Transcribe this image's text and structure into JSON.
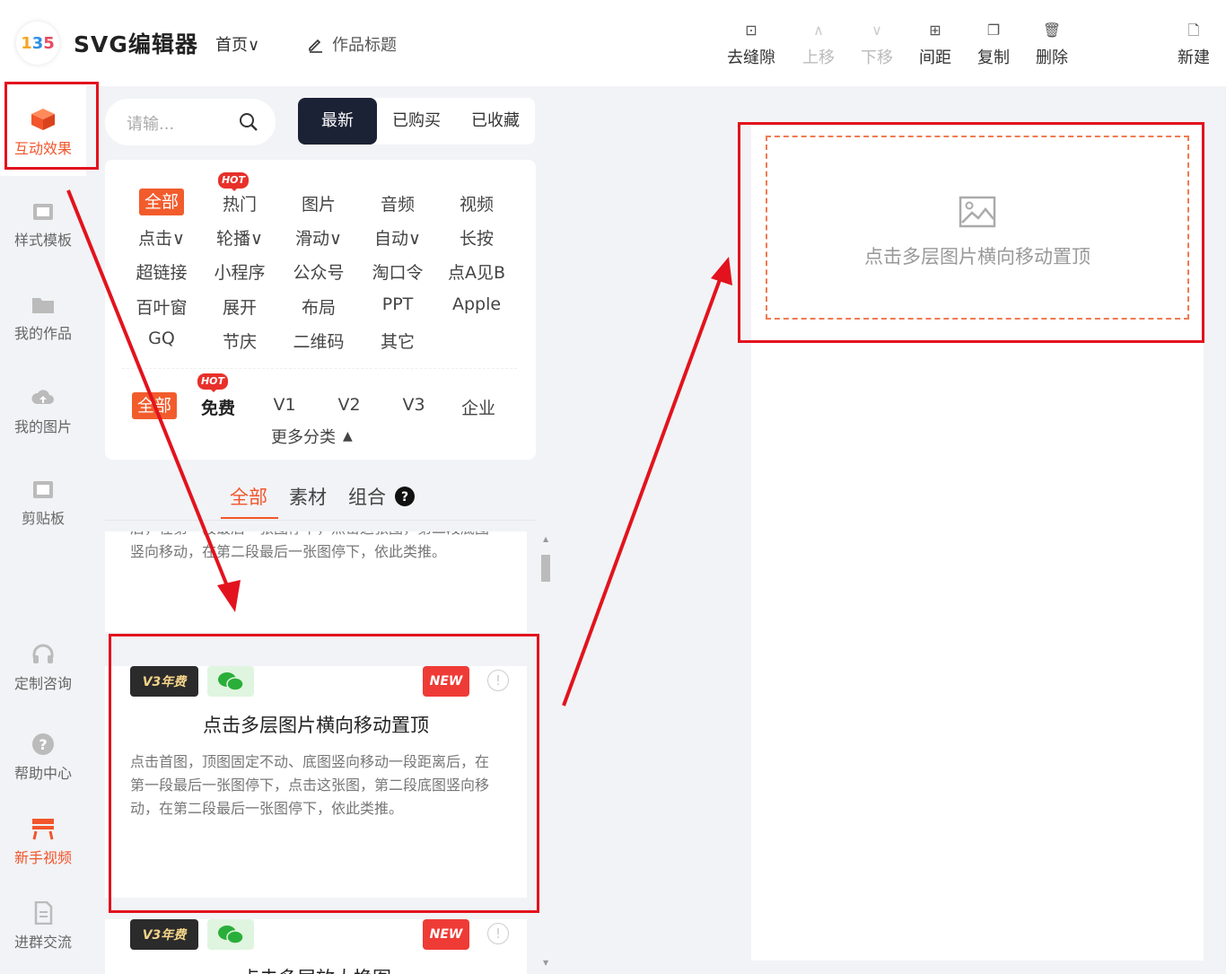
{
  "header": {
    "app_name": "SVG编辑器",
    "home_label": "首页∨",
    "work_title": "作品标题",
    "tools": [
      {
        "label": "去缝隙",
        "icon": "gap-icon",
        "disabled": false
      },
      {
        "label": "上移",
        "icon": "chevron-up-icon",
        "disabled": true
      },
      {
        "label": "下移",
        "icon": "chevron-down-icon",
        "disabled": true
      },
      {
        "label": "间距",
        "icon": "spacing-icon",
        "disabled": false
      },
      {
        "label": "复制",
        "icon": "copy-icon",
        "disabled": false
      },
      {
        "label": "删除",
        "icon": "trash-icon",
        "disabled": false
      },
      {
        "label": "新建",
        "icon": "new-file-icon",
        "disabled": false
      }
    ]
  },
  "sidebar": {
    "items": [
      {
        "label": "互动效果",
        "icon": "cube-icon"
      },
      {
        "label": "样式模板",
        "icon": "template-icon"
      },
      {
        "label": "我的作品",
        "icon": "folder-icon"
      },
      {
        "label": "我的图片",
        "icon": "cloud-icon"
      },
      {
        "label": "剪贴板",
        "icon": "clipboard-icon"
      },
      {
        "label": "定制咨询",
        "icon": "headset-icon"
      },
      {
        "label": "帮助中心",
        "icon": "help-icon"
      },
      {
        "label": "新手视频",
        "icon": "video-icon"
      },
      {
        "label": "进群交流",
        "icon": "document-icon"
      }
    ]
  },
  "search": {
    "placeholder": "请输..."
  },
  "sort_tabs": [
    "最新",
    "已购买",
    "已收藏"
  ],
  "categories": {
    "hot_badge": "HOT",
    "rows": [
      [
        "全部",
        "热门",
        "图片",
        "音频",
        "视频"
      ],
      [
        "点击∨",
        "轮播∨",
        "滑动∨",
        "自动∨",
        "长按"
      ],
      [
        "超链接",
        "小程序",
        "公众号",
        "淘口令",
        "点A见B"
      ],
      [
        "百叶窗",
        "展开",
        "布局",
        "PPT",
        "Apple"
      ],
      [
        "GQ",
        "节庆",
        "二维码",
        "其它"
      ]
    ],
    "versions": [
      "全部",
      "免费",
      "V1",
      "V2",
      "V3",
      "企业"
    ],
    "more": "更多分类"
  },
  "content_tabs": [
    "全部",
    "素材",
    "组合"
  ],
  "list": {
    "partial_desc": "后，在第一段最后一张图停下，点击这张图，第二段底图竖向移动，在第二段最后一张图停下，依此类推。",
    "badge_v3": "V3年费",
    "badge_new": "NEW",
    "info": "!",
    "card_title": "点击多层图片横向移动置顶",
    "card_desc": "点击首图，顶图固定不动、底图竖向移动一段距离后，在第一段最后一张图停下，点击这张图，第二段底图竖向移动，在第二段最后一张图停下，依此类推。",
    "next_title": "点击多层放大换图"
  },
  "canvas": {
    "placeholder_text": "点击多层图片横向移动置顶"
  },
  "colors": {
    "accent": "#f2552c",
    "annotation_red": "#e2131e",
    "dark_tab": "#1c2235"
  }
}
